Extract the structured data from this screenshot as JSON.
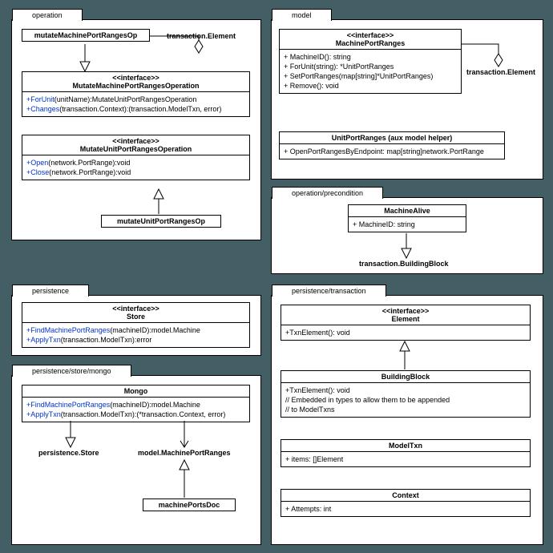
{
  "packages": {
    "operation": {
      "tab": "operation"
    },
    "model": {
      "tab": "model"
    },
    "precond": {
      "tab": "operation/precondition"
    },
    "persistence": {
      "tab": "persistence"
    },
    "pttxn": {
      "tab": "persistence/transaction"
    },
    "mongo": {
      "tab": "persistence/store/mongo"
    }
  },
  "classes": {
    "mutateMachinePortRangesOp": {
      "name": "mutateMachinePortRangesOp"
    },
    "txn_element_label1": {
      "name": "transaction.Element"
    },
    "mmpro_iface": {
      "stereo": "<<interface>>",
      "name": "MutateMachinePortRangesOperation",
      "m1a": "+ForUnit",
      "m1b": "(unitName):MutateUnitPortRangesOperation",
      "m2a": "+Changes",
      "m2b": "(transaction.Context):(transaction.ModelTxn, error)"
    },
    "mupro_iface": {
      "stereo": "<<interface>>",
      "name": "MutateUnitPortRangesOperation",
      "m1a": "+Open",
      "m1b": "(network.PortRange):void",
      "m2a": "+Close",
      "m2b": "(network.PortRange):void"
    },
    "mutateUnitPortRangesOp": {
      "name": "mutateUnitPortRangesOp"
    },
    "machineportranges": {
      "stereo": "<<interface>>",
      "name": "MachinePortRanges",
      "m1": "+ MachineID(): string",
      "m2": "+ ForUnit(string): *UnitPortRanges",
      "m3": "+ SetPortRanges(map[string]*UnitPortRanges)",
      "m4": "+ Remove(): void"
    },
    "txn_element_label2": {
      "name": "transaction.Element"
    },
    "unitportranges": {
      "name": "UnitPortRanges (aux model helper)",
      "m1": "+ OpenPortRangesByEndpoint: map[string]network.PortRange"
    },
    "machinealive": {
      "name": "MachineAlive",
      "m1": "+ MachineID: string"
    },
    "txn_buildingblock_label": {
      "name": "transaction.BuildingBlock"
    },
    "store": {
      "stereo": "<<interface>>",
      "name": "Store",
      "m1a": "+FindMachinePortRanges",
      "m1b": "(machineID):model.Machine",
      "m2a": "+ApplyTxn",
      "m2b": "(transaction.ModelTxn):error"
    },
    "mongo_cls": {
      "name": "Mongo",
      "m1a": "+FindMachinePortRanges",
      "m1b": "(machineID):model.Machine",
      "m2a": "+ApplyTxn",
      "m2b": "(transaction.ModelTxn):(*transaction.Context, error)"
    },
    "persistence_store_label": {
      "name": "persistence.Store"
    },
    "model_mpr_label": {
      "name": "model.MachinePortRanges"
    },
    "machineportsdoc": {
      "name": "machinePortsDoc"
    },
    "element": {
      "stereo": "<<interface>>",
      "name": "Element",
      "m1": "+TxnElement(): void"
    },
    "buildingblock": {
      "name": "BuildingBlock",
      "m1": "+TxnElement(): void",
      "m2": "// Embedded in types to allow them to be appended",
      "m3": "// to ModelTxns"
    },
    "modeltxn": {
      "name": "ModelTxn",
      "m1": "+ items: []Element"
    },
    "context": {
      "name": "Context",
      "m1": "+ Attempts: int"
    }
  }
}
